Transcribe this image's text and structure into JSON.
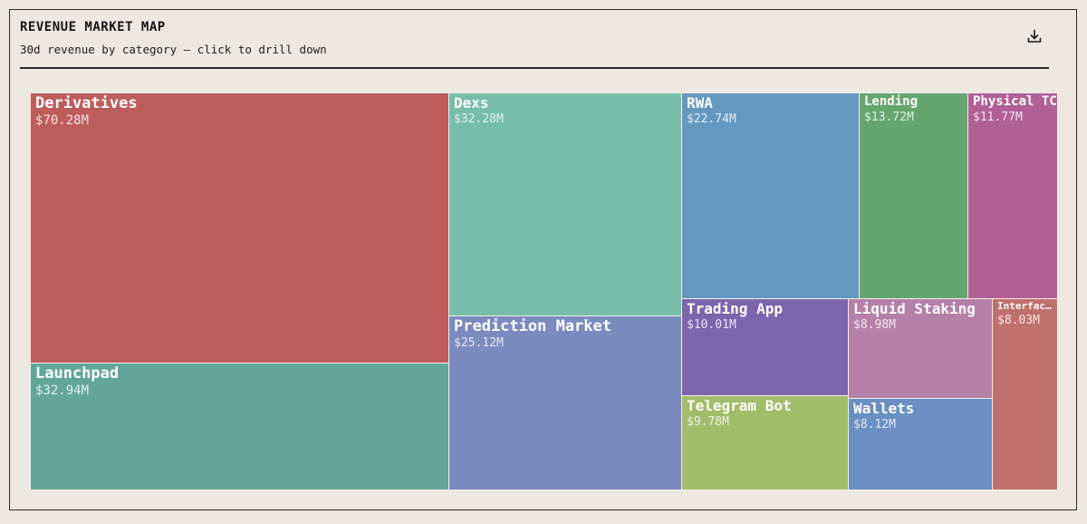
{
  "header": {
    "title": "REVENUE MARKET MAP",
    "subtitle": "30d revenue by category — click to drill down",
    "download_icon": "download-icon"
  },
  "chart_data": {
    "type": "treemap",
    "title": "REVENUE MARKET MAP",
    "subtitle": "30d revenue by category — click to drill down",
    "unit": "$M",
    "items": [
      {
        "label": "Derivatives",
        "display": "Derivatives",
        "value_label": "$70.28M",
        "value": 70.28,
        "color": "#bd5d5b"
      },
      {
        "label": "Launchpad",
        "display": "Launchpad",
        "value_label": "$32.94M",
        "value": 32.94,
        "color": "#63a697"
      },
      {
        "label": "Dexs",
        "display": "Dexs",
        "value_label": "$32.28M",
        "value": 32.28,
        "color": "#76bea9"
      },
      {
        "label": "Prediction Market",
        "display": "Prediction Market",
        "value_label": "$25.12M",
        "value": 25.12,
        "color": "#7b8bbf"
      },
      {
        "label": "RWA",
        "display": "RWA",
        "value_label": "$22.74M",
        "value": 22.74,
        "color": "#6598c0"
      },
      {
        "label": "Lending",
        "display": "Lending",
        "value_label": "$13.72M",
        "value": 13.72,
        "color": "#64a66e"
      },
      {
        "label": "Physical TCG",
        "display": "Physical TC",
        "value_label": "$11.77M",
        "value": 11.77,
        "color": "#b06096"
      },
      {
        "label": "Trading App",
        "display": "Trading App",
        "value_label": "$10.01M",
        "value": 10.01,
        "color": "#7c65ac"
      },
      {
        "label": "Telegram Bot",
        "display": "Telegram Bot",
        "value_label": "$9.78M",
        "value": 9.78,
        "color": "#a2bd6a"
      },
      {
        "label": "Liquid Staking",
        "display": "Liquid Staking",
        "value_label": "$8.98M",
        "value": 8.98,
        "color": "#b580a8"
      },
      {
        "label": "Wallets",
        "display": "Wallets",
        "value_label": "$8.12M",
        "value": 8.12,
        "color": "#6a8fc2"
      },
      {
        "label": "Interface",
        "display": "Interfac…",
        "value_label": "$8.03M",
        "value": 8.03,
        "color": "#c0706c"
      }
    ]
  }
}
